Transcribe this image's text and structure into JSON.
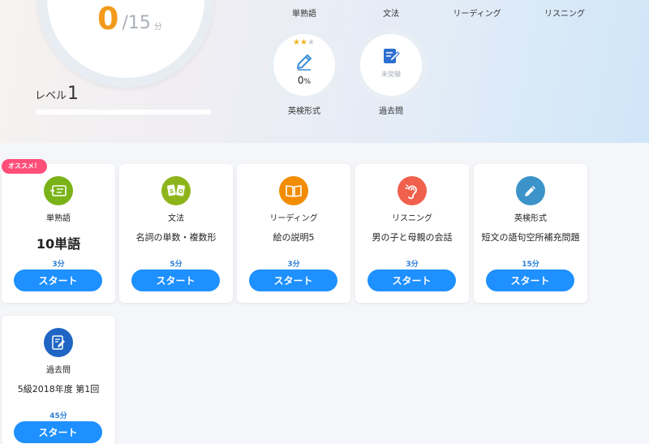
{
  "score": {
    "current": "0",
    "total": "/15",
    "unit": "分"
  },
  "level": {
    "label": "レベル",
    "number": "1"
  },
  "top_categories": [
    "単熟語",
    "文法",
    "リーディング",
    "リスニング"
  ],
  "modes": [
    {
      "label": "英検形式",
      "percent": "0",
      "percent_unit": "%",
      "icon": "pencil-icon",
      "stars_filled": 2,
      "stars_total": 3
    },
    {
      "label": "過去問",
      "status": "未受験",
      "icon": "document-icon"
    }
  ],
  "badge": "オススメ！",
  "cards": [
    {
      "category": "単熟語",
      "title": "10単語",
      "time": "3分",
      "button": "スタート",
      "icon": "vocabulary-icon",
      "color": "#7ab317"
    },
    {
      "category": "文法",
      "title": "名詞の単数・複数形",
      "time": "5分",
      "button": "スタート",
      "icon": "grammar-icon",
      "color": "#8db51b"
    },
    {
      "category": "リーディング",
      "title": "絵の説明5",
      "time": "3分",
      "button": "スタート",
      "icon": "book-icon",
      "color": "#f28c00"
    },
    {
      "category": "リスニング",
      "title": "男の子と母親の会話",
      "time": "3分",
      "button": "スタート",
      "icon": "ear-icon",
      "color": "#f0604c"
    },
    {
      "category": "英検形式",
      "title": "短文の語句空所補充問題",
      "time": "15分",
      "button": "スタート",
      "icon": "pencil-icon",
      "color": "#3b93c9"
    },
    {
      "category": "過去問",
      "title": "5級2018年度 第1回",
      "time": "45分",
      "button": "スタート",
      "icon": "document-icon",
      "color": "#1f65c4"
    }
  ],
  "colors": {
    "accent": "#1e90ff",
    "score": "#f29a1a",
    "badge": "#ff4f79"
  }
}
